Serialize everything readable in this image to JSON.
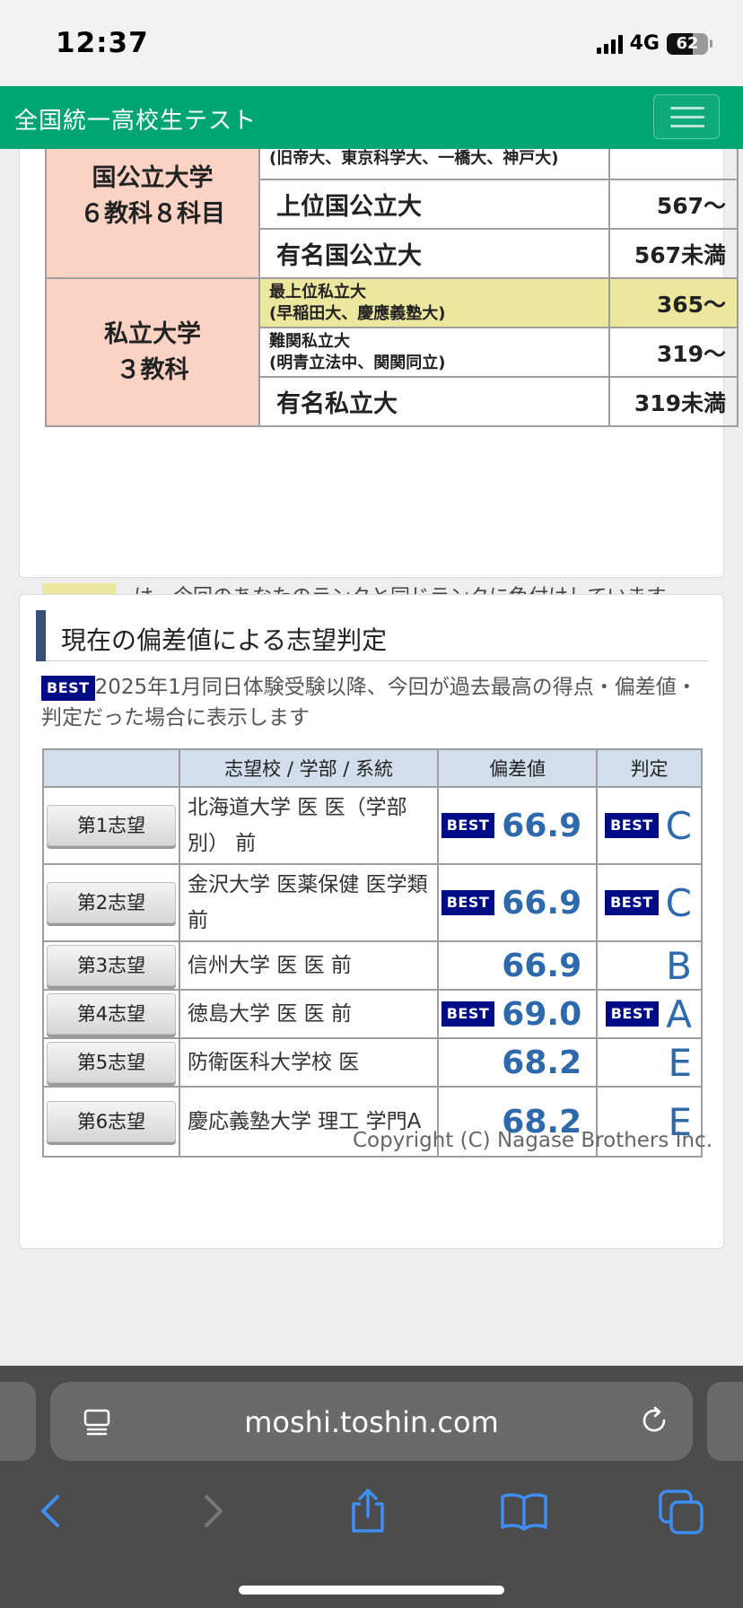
{
  "status": {
    "time": "12:37",
    "network": "4G",
    "battery": "62",
    "battery_level": 0.62
  },
  "header": {
    "title": "全国統一高校生テスト"
  },
  "rank_table": {
    "groups": [
      {
        "label_lines": [
          "国公立大学",
          "６教科８科目"
        ],
        "rows": [
          {
            "name_lines": [
              "(旧帝大、東京科学大、一橋大、神戸大)"
            ],
            "score": "---",
            "highlight": false
          },
          {
            "name_lines": [
              "上位国公立大"
            ],
            "score": "567〜",
            "highlight": false
          },
          {
            "name_lines": [
              "有名国公立大"
            ],
            "score": "567未満",
            "highlight": false
          }
        ]
      },
      {
        "label_lines": [
          "私立大学",
          "３教科"
        ],
        "rows": [
          {
            "name_lines": [
              "最上位私立大",
              "(早稲田大、慶應義塾大)"
            ],
            "score": "365〜",
            "highlight": true
          },
          {
            "name_lines": [
              "難関私立大",
              "(明青立法中、関関同立)"
            ],
            "score": "319〜",
            "highlight": false
          },
          {
            "name_lines": [
              "有名私立大"
            ],
            "score": "319未満",
            "highlight": false
          }
        ]
      }
    ],
    "legend_text": "は、今回のあなたのランクと同じランクに色付けしています。",
    "highlight_color": "#ece79f"
  },
  "wish_section": {
    "title": "現在の偏差値による志望判定",
    "best_label": "BEST",
    "note": "2025年1月同日体験受験以降、今回が過去最高の得点・偏差値・判定だった場合に表示します",
    "columns": [
      "",
      "志望校 / 学部 / 系統",
      "偏差値",
      "判定"
    ],
    "rows": [
      {
        "button": "第1志望",
        "school": "北海道大学 医 医（学部別） 前",
        "deviation": "66.9",
        "deviation_best": true,
        "judgement": "C",
        "judgement_best": true
      },
      {
        "button": "第2志望",
        "school": "金沢大学 医薬保健 医学類 前",
        "deviation": "66.9",
        "deviation_best": true,
        "judgement": "C",
        "judgement_best": true
      },
      {
        "button": "第3志望",
        "school": "信州大学 医 医 前",
        "deviation": "66.9",
        "deviation_best": false,
        "judgement": "B",
        "judgement_best": false
      },
      {
        "button": "第4志望",
        "school": "徳島大学 医 医 前",
        "deviation": "69.0",
        "deviation_best": true,
        "judgement": "A",
        "judgement_best": true
      },
      {
        "button": "第5志望",
        "school": "防衛医科大学校 医",
        "deviation": "68.2",
        "deviation_best": false,
        "judgement": "E",
        "judgement_best": false
      },
      {
        "button": "第6志望",
        "school": "慶応義塾大学 理工 学門A",
        "deviation": "68.2",
        "deviation_best": false,
        "judgement": "E",
        "judgement_best": false
      }
    ]
  },
  "footer": {
    "copyright": "Copyright (C) Nagase Brothers Inc."
  },
  "browser": {
    "url": "moshi.toshin.com"
  },
  "colors": {
    "header_green": "#00a572",
    "accent_blue": "#2e69ac",
    "best_navy": "#000b86",
    "rank_label_bg": "#fbd3c5"
  }
}
